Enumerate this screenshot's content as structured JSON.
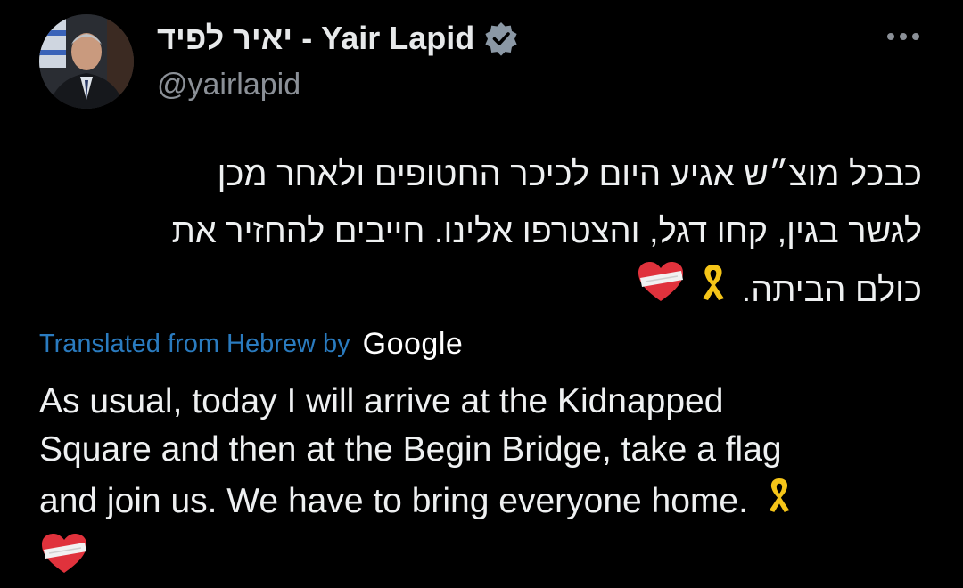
{
  "author": {
    "display_name": "יאיר לפיד - Yair Lapid",
    "handle": "@yairlapid",
    "verified": true
  },
  "tweet": {
    "hebrew_lines": [
      "כבכל מוצ״ש אגיע היום לכיכר החטופים ולאחר מכן",
      "לגשר בגין, קחו דגל, והצטרפו אלינו. חייבים להחזיר את",
      "כולם הביתה."
    ],
    "translation_label": "Translated from Hebrew by",
    "translation_provider": "Google",
    "english_lines": [
      "As usual, today I will arrive at the Kidnapped",
      "Square and then at the Begin Bridge, take a flag",
      "and join us. We have to bring everyone home."
    ],
    "emojis": [
      "yellow-ribbon",
      "bandaged-heart"
    ]
  },
  "colors": {
    "background": "#000000",
    "text": "#e7e9ea",
    "handle": "#8b9097",
    "translated_link": "#2a7bbf",
    "verified_badge": "#8b98a5",
    "ribbon": "#f5c518",
    "heart": "#e0323c"
  }
}
